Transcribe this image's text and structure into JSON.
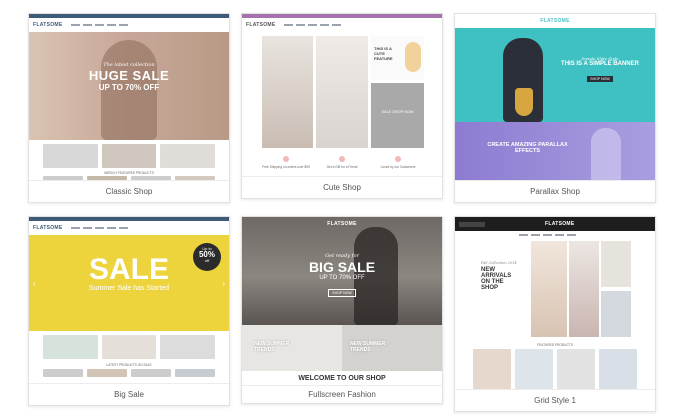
{
  "cards": [
    {
      "label": "Classic Shop"
    },
    {
      "label": "Cute Shop"
    },
    {
      "label": "Parallax Shop"
    },
    {
      "label": "Big Sale"
    },
    {
      "label": "Fullscreen Fashion"
    },
    {
      "label": "Grid Style 1"
    }
  ],
  "brand": "FLATSOME",
  "classic": {
    "script": "The latest collection",
    "headline": "HUGE SALE",
    "sub": "UP TO 70% OFF",
    "section": "WEEKLY FEATURED PRODUCTS"
  },
  "cute": {
    "promo1": "THIS IS A CUTE FEATURE",
    "promo2": "SALE DROP NOW",
    "features": [
      "Free Shipping on orders over $99",
      "Get a Gift for a Friend",
      "Loved by our Customers"
    ]
  },
  "parallax": {
    "script": "Simple Slide Style",
    "headline": "THIS IS A SIMPLE BANNER",
    "button": "SHOP NOW",
    "headline2": "CREATE AMAZING PARALLAX EFFECTS"
  },
  "bigsale": {
    "headline": "SALE",
    "sub": "Summer Sale has Started",
    "badge_top": "Up to",
    "badge_value": "50%",
    "badge_bottom": "off",
    "section": "LATEST PRODUCTS ON SALE"
  },
  "fullscreen": {
    "script": "Get ready for",
    "headline": "BIG SALE",
    "sub": "UP TO 70% OFF",
    "button": "SHOP NOW",
    "promo_left": "NEW SUMMER TRENDS",
    "promo_right": "NEW SUMMER TRENDS",
    "welcome": "WELCOME TO OUR SHOP"
  },
  "grid": {
    "script": "Fall Collection 2014",
    "headline": "NEW ARRIVALS ON THE SHOP",
    "section": "FEATURED PRODUCTS"
  }
}
